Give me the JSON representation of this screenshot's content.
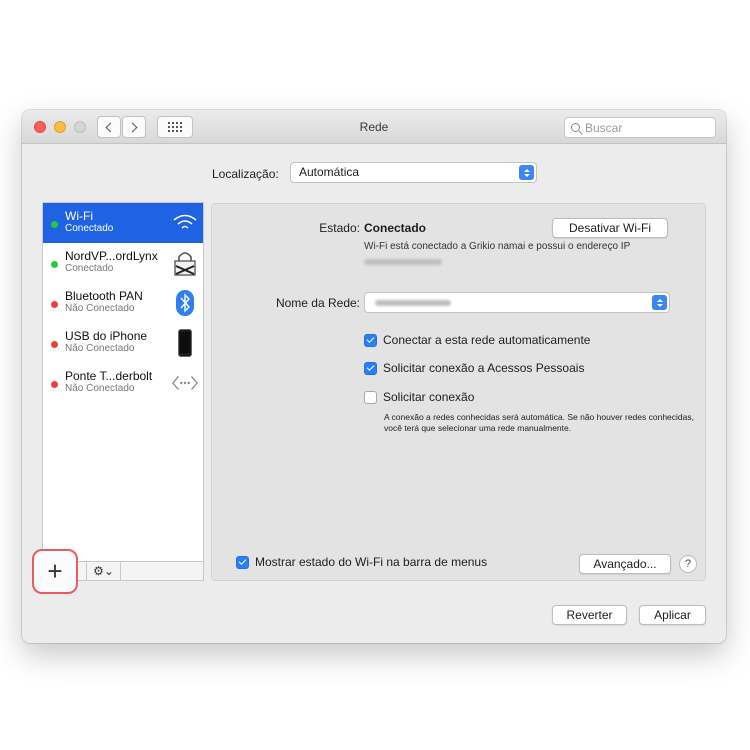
{
  "window": {
    "title": "Rede",
    "search_placeholder": "Buscar"
  },
  "location": {
    "label": "Localização:",
    "value": "Automática"
  },
  "services": [
    {
      "name": "Wi-Fi",
      "status": "Conectado",
      "status_color": "#28c840",
      "selected": true,
      "icon": "wifi-icon"
    },
    {
      "name": "NordVP...ordLynx",
      "status": "Conectado",
      "status_color": "#28c840",
      "selected": false,
      "icon": "vpn-lock-icon"
    },
    {
      "name": "Bluetooth PAN",
      "status": "Não Conectado",
      "status_color": "#f0403a",
      "selected": false,
      "icon": "bluetooth-icon"
    },
    {
      "name": "USB do iPhone",
      "status": "Não Conectado",
      "status_color": "#f0403a",
      "selected": false,
      "icon": "iphone-icon"
    },
    {
      "name": "Ponte T...derbolt",
      "status": "Não Conectado",
      "status_color": "#f0403a",
      "selected": false,
      "icon": "thunderbolt-bridge-icon"
    }
  ],
  "sidebar_footer": {
    "add": "+",
    "remove": "-",
    "gear": "⚙︎⌄"
  },
  "detail": {
    "status_label": "Estado:",
    "status_value": "Conectado",
    "status_description": "Wi-Fi está conectado a Grikio namai e possui o endereço IP",
    "turn_off_button": "Desativar Wi-Fi",
    "network_name_label": "Nome da Rede:",
    "checkboxes": [
      {
        "label": "Conectar a esta rede automaticamente",
        "checked": true
      },
      {
        "label": "Solicitar conexão a Acessos Pessoais",
        "checked": true
      },
      {
        "label": "Solicitar conexão",
        "checked": false
      }
    ],
    "note": "A conexão a redes conhecidas será automática. Se não houver redes conhecidas, você terá que selecionar uma rede manualmente.",
    "show_status_checkbox": {
      "label": "Mostrar estado do Wi-Fi na barra de menus",
      "checked": true
    },
    "advanced_button": "Avançado...",
    "help": "?"
  },
  "footer": {
    "revert_button": "Reverter",
    "apply_button": "Aplicar"
  },
  "highlight": {
    "color": "#e85b64",
    "label": "+"
  },
  "colors": {
    "accent": "#1f63e4",
    "checkbox": "#2c7ef7"
  }
}
